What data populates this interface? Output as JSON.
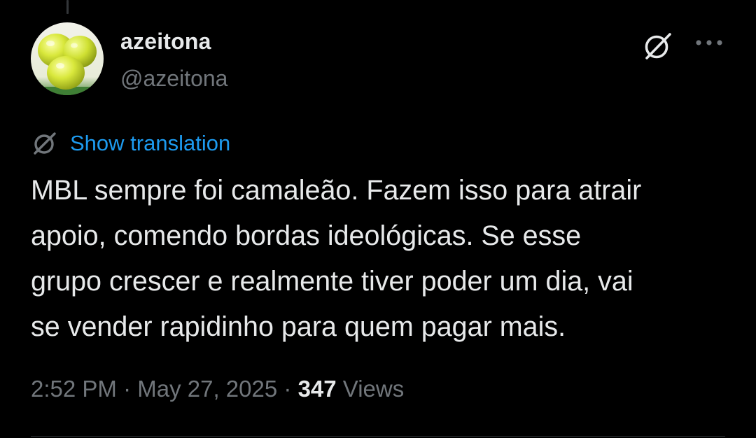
{
  "author": {
    "display_name": "azeitona",
    "handle": "@azeitona"
  },
  "translate": {
    "label": "Show translation"
  },
  "tweet": {
    "text": "MBL sempre foi camaleão. Fazem isso para atrair\napoio, comendo bordas ideológicas. Se esse\ngrupo crescer e realmente tiver poder um dia, vai\nse vender rapidinho para quem pagar mais."
  },
  "meta": {
    "time": "2:52 PM",
    "separator": "·",
    "date": "May 27, 2025",
    "views_count": "347",
    "views_label": "Views"
  },
  "icons": {
    "grok": "grok-icon",
    "more": "more-icon",
    "translate": "translate-icon"
  },
  "colors": {
    "background": "#000000",
    "text_primary": "#e7e9ea",
    "text_secondary": "#71767b",
    "link": "#1d9bf0"
  }
}
